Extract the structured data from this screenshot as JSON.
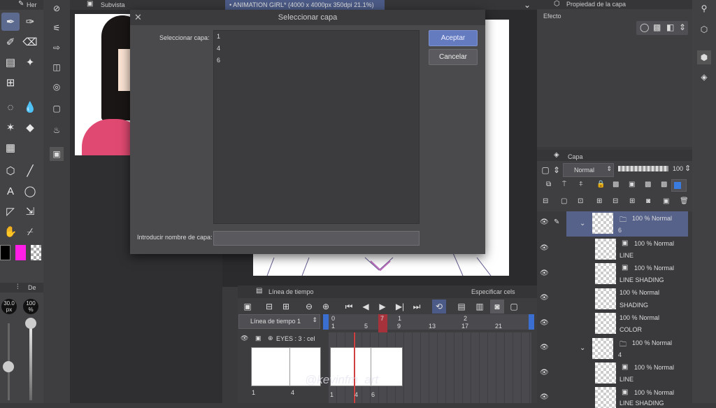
{
  "left_toolbar": {
    "header_tab": "Her",
    "sub_tab": "De",
    "brush_size": "30.0",
    "brush_unit": "px",
    "opacity": "100",
    "opacity_unit": "%"
  },
  "tabs": {
    "subview": "Subvista",
    "canvas_title": "ANIMATION GIRL* (4000 x 4000px 350dpi 21.1%)"
  },
  "dialog": {
    "title": "Seleccionar capa",
    "select_label": "Seleccionar capa:",
    "layers": [
      "1",
      "4",
      "6"
    ],
    "ok": "Aceptar",
    "cancel": "Cancelar",
    "name_label": "Introducir nombre de capa:",
    "name_value": ""
  },
  "layer_property": {
    "title": "Propiedad de la capa",
    "effect_label": "Efecto"
  },
  "layer_panel": {
    "title": "Capa",
    "blend_mode": "Normal",
    "opacity": "100",
    "layers": [
      {
        "percent": "100 %",
        "mode": "Normal",
        "name": "6"
      },
      {
        "percent": "100 %",
        "mode": "Normal",
        "name": "LINE"
      },
      {
        "percent": "100 %",
        "mode": "Normal",
        "name": "LINE SHADING"
      },
      {
        "percent": "100 %",
        "mode": "Normal",
        "name": "SHADING"
      },
      {
        "percent": "100 %",
        "mode": "Normal",
        "name": "COLOR"
      },
      {
        "percent": "100 %",
        "mode": "Normal",
        "name": "4"
      },
      {
        "percent": "100 %",
        "mode": "Normal",
        "name": "LINE"
      },
      {
        "percent": "100 %",
        "mode": "Normal",
        "name": "LINE SHADING"
      }
    ]
  },
  "timeline": {
    "title": "Línea de tiempo",
    "specify_cels": "Especificar cels",
    "dropdown": "Línea de tiempo 1",
    "track_name": "EYES : 3 : cel",
    "ruler_top": [
      "0",
      "7",
      "1",
      "2"
    ],
    "ruler_bottom": [
      "1",
      "5",
      "9",
      "13",
      "17",
      "21"
    ],
    "cel_numbers_left": [
      "1",
      "4"
    ],
    "cel_numbers_right": [
      "1",
      "4",
      "6"
    ],
    "watermark": "@kevinfm_art"
  }
}
